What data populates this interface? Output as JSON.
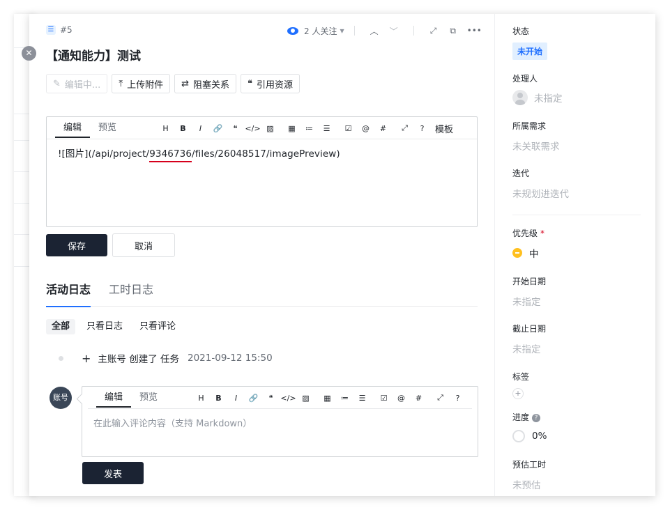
{
  "task": {
    "id": "#5",
    "title": "【通知能力】测试"
  },
  "top": {
    "followers": "2 人关注"
  },
  "toolbar": {
    "editing": "编辑中...",
    "upload": "上传附件",
    "block": "阻塞关系",
    "cite": "引用资源"
  },
  "editor": {
    "tab_edit": "编辑",
    "tab_preview": "预览",
    "template": "模板",
    "content_prefix": "![图片](/api/project/",
    "content_highlight": "9346736",
    "content_suffix": "/files/26048517/imagePreview)",
    "save": "保存",
    "cancel": "取消"
  },
  "log": {
    "tab_activity": "活动日志",
    "tab_worktime": "工时日志",
    "filter_all": "全部",
    "filter_logs": "只看日志",
    "filter_comments": "只看评论",
    "entry_text": "主账号 创建了 任务",
    "entry_time": "2021-09-12 15:50"
  },
  "comment": {
    "avatar": "账号",
    "tab_edit": "编辑",
    "tab_preview": "预览",
    "placeholder": "在此输入评论内容（支持 Markdown）",
    "publish": "发表"
  },
  "sidebar": {
    "status_label": "状态",
    "status_value": "未开始",
    "assignee_label": "处理人",
    "assignee_value": "未指定",
    "requirement_label": "所属需求",
    "requirement_value": "未关联需求",
    "iteration_label": "迭代",
    "iteration_value": "未规划进迭代",
    "priority_label": "优先级",
    "priority_value": "中",
    "start_label": "开始日期",
    "start_value": "未指定",
    "due_label": "截止日期",
    "due_value": "未指定",
    "tags_label": "标签",
    "progress_label": "进度",
    "progress_value": "0%",
    "estimate_label": "预估工时",
    "estimate_value": "未预估"
  },
  "colors": {
    "accent": "#1f6fff",
    "primary_button": "#1b2333",
    "highlight_underline": "#d6001c",
    "priority_medium": "#ffc01f"
  }
}
